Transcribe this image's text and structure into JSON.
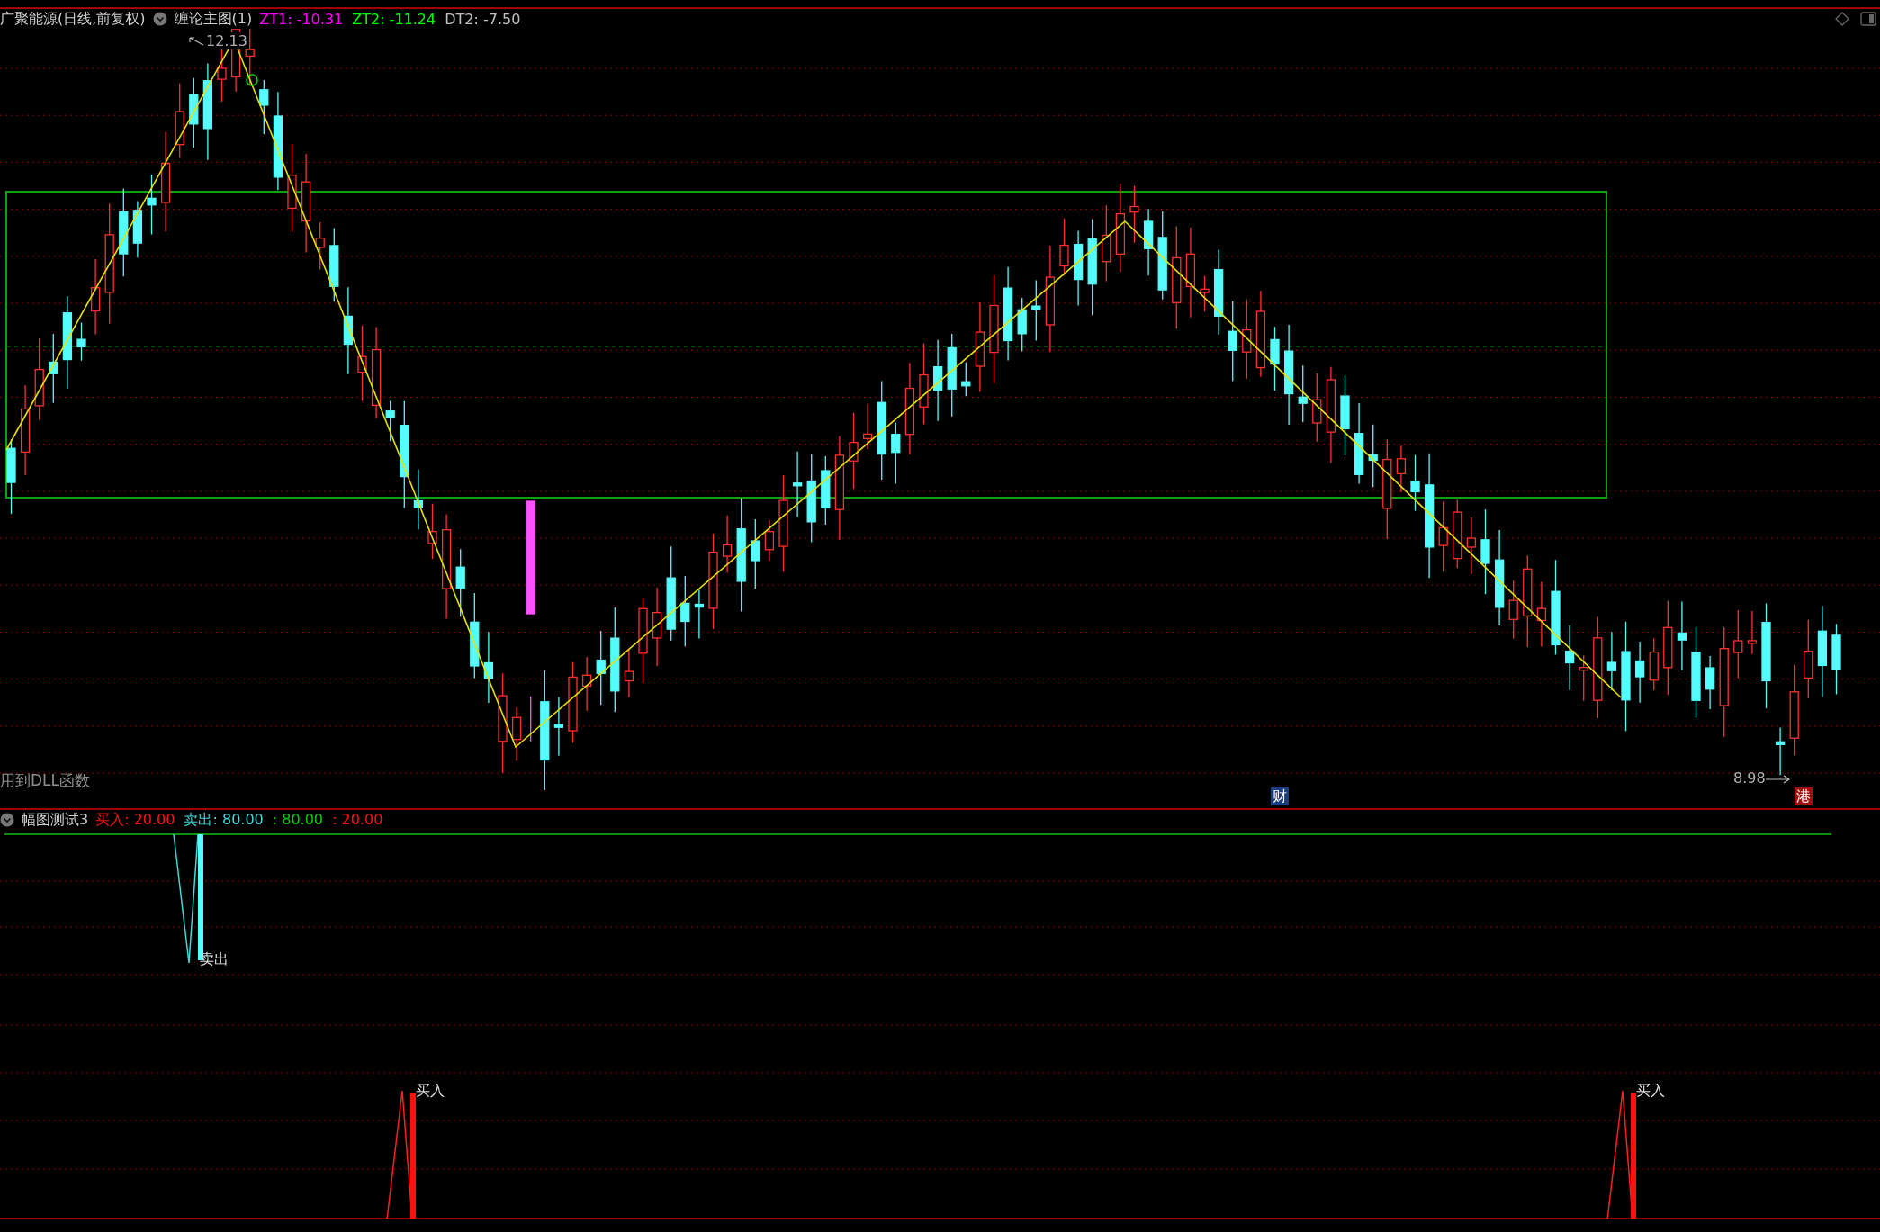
{
  "header": {
    "security": "广聚能源(日线,前复权)",
    "indicator": "缠论主图(1)",
    "readings": [
      {
        "text": "ZT1: -10.31",
        "color": "#ff00ff"
      },
      {
        "text": "ZT2: -11.24",
        "color": "#00ff00"
      },
      {
        "text": "DT2: -7.50",
        "color": "#c0c0c0"
      }
    ]
  },
  "main_chart": {
    "high_label": "12.13",
    "low_label": "8.98",
    "note": "用到DLL函数",
    "markers": [
      {
        "text": "财",
        "kind": "finance"
      },
      {
        "text": "港",
        "kind": "hk"
      }
    ]
  },
  "sub_indicator": {
    "name": "幅图测试3",
    "readings": [
      {
        "text": "买入: 20.00",
        "color": "#ff1010"
      },
      {
        "text": "卖出: 80.00",
        "color": "#40d8d8"
      },
      {
        "text": ": 80.00",
        "color": "#00d000"
      },
      {
        "text": ": 20.00",
        "color": "#ff1010"
      }
    ],
    "signals": [
      {
        "text": "卖出",
        "kind": "sell"
      },
      {
        "text": "买入",
        "kind": "buy"
      },
      {
        "text": "买入",
        "kind": "buy"
      }
    ]
  }
}
